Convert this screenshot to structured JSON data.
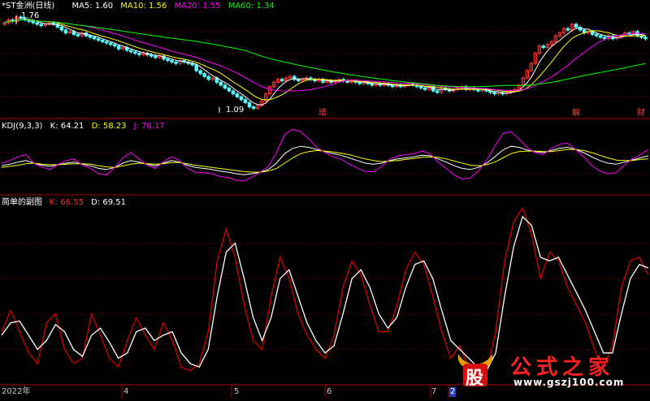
{
  "colors": {
    "bg": "#000000",
    "panel_border": "#b00000",
    "grid": "#5a0000",
    "up": "#ff3232",
    "down": "#54ffff",
    "ma5": "#ffffff",
    "ma10": "#ffff00",
    "ma20": "#ff00ff",
    "ma60": "#00ff00",
    "k": "#ffffff",
    "d": "#ffff00",
    "j": "#ff00ff",
    "k2": "#d40000",
    "d2": "#ffffff",
    "axis_text": "#c8c8c8"
  },
  "header_main": {
    "title": "*ST金洲(日线)",
    "ma5": "MA5: 1.60",
    "ma10": "MA10: 1.56",
    "ma20": "MA20: 1.55",
    "ma60": "MA60: 1.34"
  },
  "header_kdj": {
    "title": "KDJ(9,3,3)",
    "k": "K: 64.21",
    "d": "D: 58.23",
    "j": "J: 76.17"
  },
  "header_custom": {
    "title": "简单的副图",
    "k": "K: 66.55",
    "d": "D: 69.51"
  },
  "annotations": {
    "high_price": "1.76",
    "low_price": "1.09",
    "event_1": "增",
    "event_2": "解",
    "event_3": "财"
  },
  "x_axis": {
    "labels": [
      "2022年",
      "4",
      "5",
      "6",
      "7",
      "2"
    ]
  },
  "watermark": {
    "icon_text": "股",
    "cn": "公式之家",
    "url": "www.gszj100.com"
  },
  "chart_data": [
    {
      "type": "candlestick",
      "title": "*ST金洲(日线)",
      "ylim": [
        1.05,
        1.8
      ],
      "close": [
        1.71,
        1.73,
        1.72,
        1.75,
        1.74,
        1.73,
        1.72,
        1.71,
        1.7,
        1.69,
        1.7,
        1.71,
        1.7,
        1.68,
        1.66,
        1.64,
        1.65,
        1.63,
        1.62,
        1.64,
        1.62,
        1.61,
        1.6,
        1.59,
        1.58,
        1.57,
        1.56,
        1.55,
        1.53,
        1.54,
        1.52,
        1.51,
        1.5,
        1.49,
        1.5,
        1.49,
        1.48,
        1.47,
        1.48,
        1.46,
        1.45,
        1.44,
        1.43,
        1.45,
        1.44,
        1.43,
        1.42,
        1.38,
        1.36,
        1.34,
        1.32,
        1.33,
        1.3,
        1.28,
        1.26,
        1.24,
        1.22,
        1.2,
        1.18,
        1.16,
        1.13,
        1.12,
        1.14,
        1.17,
        1.22,
        1.27,
        1.3,
        1.32,
        1.31,
        1.33,
        1.34,
        1.32,
        1.31,
        1.32,
        1.33,
        1.32,
        1.31,
        1.32,
        1.3,
        1.31,
        1.3,
        1.31,
        1.32,
        1.31,
        1.3,
        1.31,
        1.3,
        1.29,
        1.3,
        1.29,
        1.28,
        1.29,
        1.28,
        1.29,
        1.28,
        1.27,
        1.28,
        1.27,
        1.28,
        1.29,
        1.28,
        1.27,
        1.26,
        1.25,
        1.27,
        1.24,
        1.23,
        1.26,
        1.25,
        1.24,
        1.25,
        1.26,
        1.27,
        1.25,
        1.26,
        1.25,
        1.24,
        1.25,
        1.24,
        1.23,
        1.22,
        1.23,
        1.22,
        1.23,
        1.24,
        1.25,
        1.28,
        1.33,
        1.38,
        1.43,
        1.5,
        1.55,
        1.54,
        1.56,
        1.58,
        1.62,
        1.64,
        1.67,
        1.66,
        1.7,
        1.68,
        1.66,
        1.64,
        1.65,
        1.63,
        1.62,
        1.61,
        1.6,
        1.62,
        1.6,
        1.61,
        1.62,
        1.64,
        1.63,
        1.65,
        1.62,
        1.61,
        1.6
      ],
      "open": [
        1.7,
        1.71,
        1.73,
        1.72,
        1.75,
        1.74,
        1.73,
        1.72,
        1.71,
        1.7,
        1.69,
        1.7,
        1.71,
        1.7,
        1.68,
        1.66,
        1.64,
        1.65,
        1.63,
        1.62,
        1.64,
        1.62,
        1.61,
        1.6,
        1.59,
        1.58,
        1.57,
        1.56,
        1.55,
        1.53,
        1.54,
        1.52,
        1.51,
        1.5,
        1.49,
        1.5,
        1.49,
        1.48,
        1.47,
        1.48,
        1.46,
        1.45,
        1.44,
        1.43,
        1.45,
        1.44,
        1.43,
        1.42,
        1.38,
        1.36,
        1.34,
        1.32,
        1.33,
        1.3,
        1.28,
        1.26,
        1.24,
        1.22,
        1.2,
        1.18,
        1.16,
        1.13,
        1.12,
        1.14,
        1.17,
        1.22,
        1.27,
        1.3,
        1.32,
        1.31,
        1.33,
        1.34,
        1.32,
        1.31,
        1.32,
        1.33,
        1.32,
        1.31,
        1.32,
        1.3,
        1.31,
        1.3,
        1.31,
        1.32,
        1.31,
        1.3,
        1.31,
        1.3,
        1.29,
        1.3,
        1.29,
        1.28,
        1.29,
        1.28,
        1.29,
        1.28,
        1.27,
        1.28,
        1.27,
        1.28,
        1.29,
        1.28,
        1.27,
        1.26,
        1.25,
        1.27,
        1.24,
        1.23,
        1.26,
        1.25,
        1.24,
        1.25,
        1.26,
        1.27,
        1.25,
        1.26,
        1.25,
        1.24,
        1.25,
        1.24,
        1.23,
        1.22,
        1.23,
        1.22,
        1.23,
        1.24,
        1.25,
        1.28,
        1.33,
        1.38,
        1.43,
        1.5,
        1.55,
        1.54,
        1.56,
        1.58,
        1.62,
        1.64,
        1.67,
        1.66,
        1.7,
        1.68,
        1.66,
        1.64,
        1.65,
        1.63,
        1.62,
        1.61,
        1.6,
        1.62,
        1.6,
        1.61,
        1.62,
        1.64,
        1.63,
        1.65,
        1.62,
        1.61
      ],
      "ma5": 1.6,
      "ma10": 1.56,
      "ma20": 1.55,
      "ma60": 1.34
    },
    {
      "type": "line",
      "title": "KDJ(9,3,3)",
      "ylim": [
        -10,
        110
      ],
      "series": [
        {
          "name": "K",
          "values": [
            45,
            48,
            52,
            55,
            50,
            46,
            44,
            47,
            50,
            52,
            48,
            45,
            40,
            38,
            42,
            50,
            55,
            52,
            48,
            45,
            50,
            55,
            52,
            46,
            42,
            40,
            38,
            35,
            33,
            30,
            28,
            30,
            33,
            38,
            50,
            68,
            78,
            82,
            80,
            76,
            72,
            68,
            65,
            60,
            55,
            50,
            48,
            50,
            55,
            58,
            60,
            62,
            65,
            64,
            58,
            52,
            45,
            40,
            38,
            42,
            50,
            62,
            75,
            82,
            80,
            75,
            72,
            70,
            74,
            78,
            80,
            76,
            70,
            62,
            55,
            50,
            48,
            52,
            56,
            60,
            64
          ]
        },
        {
          "name": "D",
          "values": [
            42,
            44,
            46,
            49,
            50,
            48,
            47,
            47,
            48,
            49,
            49,
            48,
            45,
            43,
            42,
            45,
            48,
            50,
            49,
            48,
            49,
            51,
            51,
            49,
            46,
            44,
            42,
            40,
            38,
            36,
            34,
            33,
            33,
            35,
            40,
            50,
            60,
            68,
            72,
            74,
            73,
            71,
            69,
            66,
            62,
            58,
            55,
            53,
            54,
            55,
            57,
            59,
            61,
            62,
            61,
            58,
            54,
            50,
            46,
            45,
            47,
            52,
            60,
            68,
            72,
            73,
            73,
            72,
            72,
            74,
            76,
            76,
            74,
            70,
            65,
            60,
            56,
            55,
            55,
            57,
            58
          ]
        },
        {
          "name": "J",
          "values": [
            50,
            55,
            62,
            66,
            50,
            42,
            38,
            48,
            55,
            58,
            46,
            40,
            30,
            28,
            42,
            60,
            70,
            58,
            46,
            40,
            52,
            62,
            55,
            40,
            33,
            32,
            30,
            25,
            23,
            18,
            16,
            24,
            33,
            44,
            70,
            104,
            114,
            110,
            96,
            80,
            70,
            62,
            58,
            48,
            41,
            34,
            34,
            44,
            57,
            64,
            66,
            68,
            73,
            68,
            52,
            40,
            27,
            20,
            22,
            36,
            56,
            82,
            106,
            110,
            96,
            80,
            70,
            66,
            78,
            86,
            88,
            76,
            62,
            46,
            35,
            30,
            32,
            46,
            58,
            66,
            76
          ]
        }
      ]
    },
    {
      "type": "line",
      "title": "简单的副图",
      "ylim": [
        0,
        100
      ],
      "series": [
        {
          "name": "K",
          "values": [
            30,
            42,
            30,
            18,
            12,
            35,
            40,
            20,
            12,
            15,
            40,
            28,
            15,
            10,
            25,
            38,
            28,
            20,
            35,
            25,
            10,
            8,
            12,
            30,
            70,
            88,
            72,
            45,
            25,
            20,
            50,
            72,
            60,
            40,
            28,
            20,
            15,
            28,
            55,
            70,
            62,
            45,
            30,
            30,
            45,
            65,
            75,
            68,
            50,
            30,
            15,
            22,
            10,
            5,
            8,
            30,
            70,
            92,
            100,
            85,
            60,
            75,
            70,
            55,
            45,
            35,
            20,
            10,
            22,
            55,
            70,
            72,
            62
          ]
        },
        {
          "name": "D",
          "values": [
            28,
            35,
            36,
            28,
            20,
            25,
            34,
            30,
            20,
            16,
            28,
            32,
            24,
            15,
            18,
            30,
            32,
            25,
            28,
            30,
            18,
            12,
            10,
            20,
            50,
            75,
            80,
            60,
            38,
            25,
            38,
            60,
            65,
            50,
            35,
            25,
            18,
            22,
            40,
            60,
            65,
            55,
            40,
            32,
            38,
            55,
            68,
            70,
            60,
            42,
            25,
            20,
            15,
            10,
            8,
            18,
            50,
            78,
            95,
            90,
            72,
            70,
            72,
            62,
            52,
            42,
            30,
            18,
            18,
            40,
            60,
            68,
            66
          ]
        }
      ]
    }
  ]
}
